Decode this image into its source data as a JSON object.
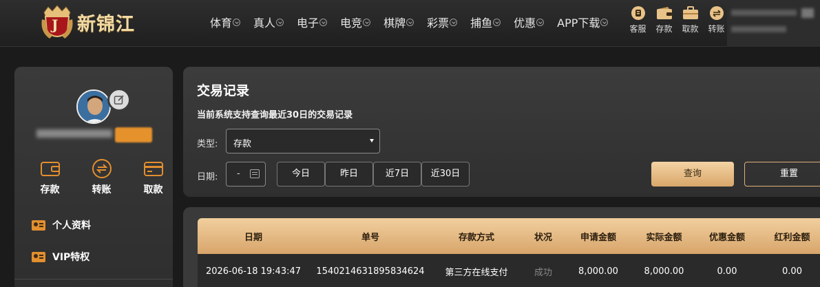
{
  "brand": {
    "name": "新锦江",
    "badge_letter": "J"
  },
  "nav": {
    "items": [
      {
        "label": "体育",
        "chevron": true
      },
      {
        "label": "真人",
        "chevron": true
      },
      {
        "label": "电子",
        "chevron": true
      },
      {
        "label": "电竞",
        "chevron": true
      },
      {
        "label": "棋牌",
        "chevron": true
      },
      {
        "label": "彩票",
        "chevron": true
      },
      {
        "label": "捕鱼",
        "chevron": true
      },
      {
        "label": "优惠",
        "chevron": true
      },
      {
        "label": "APP下载",
        "chevron": true
      }
    ]
  },
  "quick_actions": [
    {
      "label": "客服",
      "icon": "customer-service-icon"
    },
    {
      "label": "存款",
      "icon": "wallet-icon"
    },
    {
      "label": "取款",
      "icon": "briefcase-icon"
    },
    {
      "label": "转账",
      "icon": "coin-icon"
    }
  ],
  "sidebar": {
    "actions": [
      {
        "label": "存款",
        "icon": "wallet-icon"
      },
      {
        "label": "转账",
        "icon": "transfer-icon"
      },
      {
        "label": "取款",
        "icon": "card-icon"
      }
    ],
    "menu": [
      {
        "label": "个人资料",
        "icon": "profile-card-icon"
      },
      {
        "label": "VIP特权",
        "icon": "vip-card-icon"
      }
    ]
  },
  "panel": {
    "title": "交易记录",
    "subtitle": "当前系统支持查询最近30日的交易记录",
    "type_label": "类型:",
    "type_value": "存款",
    "date_label": "日期:",
    "date_value": "-",
    "quick_dates": [
      "今日",
      "昨日",
      "近7日",
      "近30日"
    ],
    "search_label": "查询",
    "reset_label": "重置"
  },
  "table": {
    "columns": [
      "日期",
      "单号",
      "存款方式",
      "状况",
      "申请金额",
      "实际金额",
      "优惠金额",
      "红利金额"
    ],
    "rows": [
      [
        "2026-06-18 19:43:47",
        "1540214631895834624",
        "第三方在线支付",
        "成功",
        "8,000.00",
        "8,000.00",
        "0.00",
        "0.00"
      ]
    ]
  },
  "colors": {
    "accent_gold": "#d9a76a",
    "menu_orange": "#e38f2e",
    "bg": "#1b1b1b",
    "panel": "#353535"
  }
}
